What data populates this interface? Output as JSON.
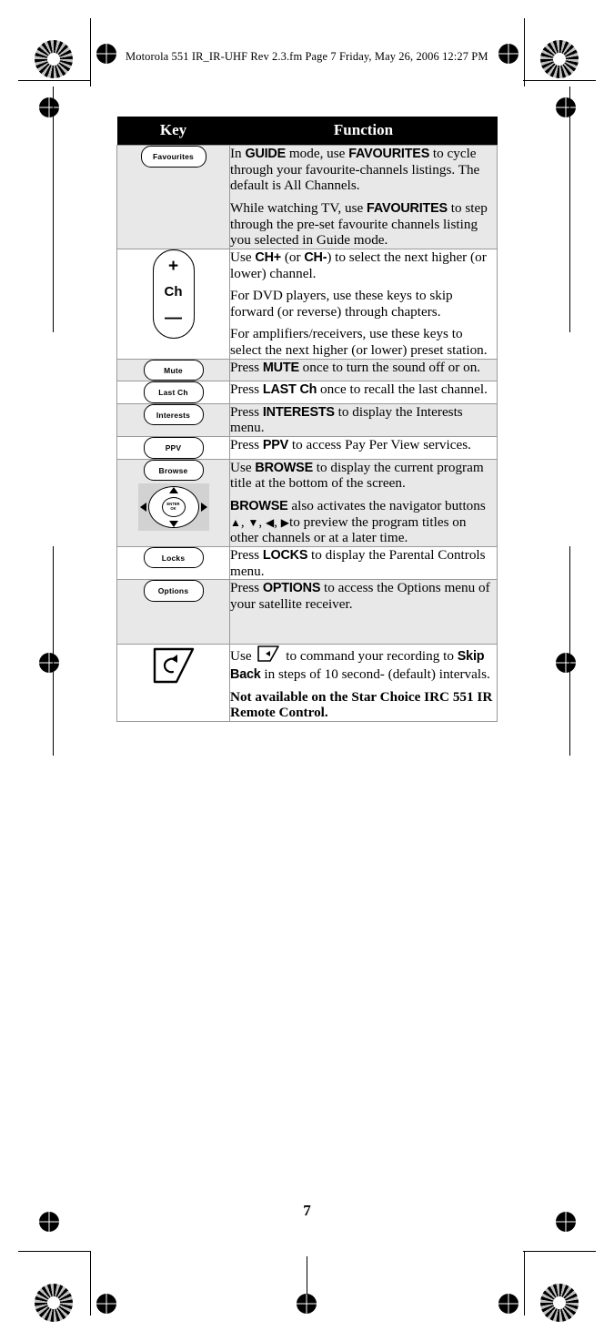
{
  "header": {
    "text": "Motorola 551 IR_IR-UHF Rev 2.3.fm  Page 7  Friday, May 26, 2006  12:27 PM"
  },
  "table": {
    "columns": [
      "Key",
      "Function"
    ],
    "rows": [
      {
        "key_label": "Favourites",
        "key_type": "pill",
        "paragraphs": [
          "In GUIDE mode, use FAVOURITES to cycle through your favourite-channels listings. The default is All Channels.",
          "While watching TV, use FAVOURITES to step through the pre-set favourite channels listing you selected in Guide mode."
        ]
      },
      {
        "key_label": "Ch",
        "key_type": "rocker",
        "rocker_plus": "+",
        "rocker_minus": "—",
        "paragraphs": [
          "Use CH+ (or CH-) to select the next higher (or lower) channel.",
          "For DVD players, use these keys to skip forward (or reverse) through chapters.",
          "For amplifiers/receivers, use these keys to select the next higher (or lower) preset station."
        ]
      },
      {
        "key_label": "Mute",
        "key_type": "pill",
        "paragraphs": [
          "Press MUTE once to turn the sound off or on."
        ]
      },
      {
        "key_label": "Last Ch",
        "key_type": "pill",
        "paragraphs": [
          "Press LAST Ch once to recall the last channel."
        ]
      },
      {
        "key_label": "Interests",
        "key_type": "pill",
        "paragraphs": [
          "Press INTERESTS to display the Interests menu."
        ]
      },
      {
        "key_label": "PPV",
        "key_type": "pill",
        "paragraphs": [
          "Press PPV to access Pay Per View services."
        ]
      },
      {
        "key_label": "Browse",
        "key_type": "browse-navpad",
        "navpad_center": "ENTER\nOK",
        "paragraphs": [
          "Use BROWSE to display the current program title at the bottom of the screen.",
          "BROWSE also activates the navigator buttons ▲, ▼, ◀, ▶ to preview the program titles on other channels or at a later time."
        ]
      },
      {
        "key_label": "Locks",
        "key_type": "pill",
        "paragraphs": [
          "Press LOCKS to display the Parental Controls menu."
        ]
      },
      {
        "key_label": "Options",
        "key_type": "pill",
        "paragraphs": [
          "Press OPTIONS to access the Options menu of your satellite receiver."
        ]
      },
      {
        "key_label": "skip-back",
        "key_type": "skip-back",
        "paragraphs": [
          "Use  to command your recording to Skip Back in steps of 10 second- (default) intervals.",
          "Not available on the Star Choice IRC 551 IR Remote Control."
        ]
      }
    ]
  },
  "footer": {
    "page_number": "7"
  },
  "bold_terms": {
    "guide": "GUIDE",
    "favourites": "FAVOURITES",
    "ch_plus": "CH+",
    "ch_minus": "CH-",
    "mute": "MUTE",
    "last_ch": "LAST Ch",
    "interests": "INTERESTS",
    "ppv": "PPV",
    "browse": "BROWSE",
    "locks": "LOCKS",
    "options": "OPTIONS",
    "skip_back": "Skip Back",
    "not_available": "Not available on the Star Choice IRC 551 IR Remote Control."
  }
}
